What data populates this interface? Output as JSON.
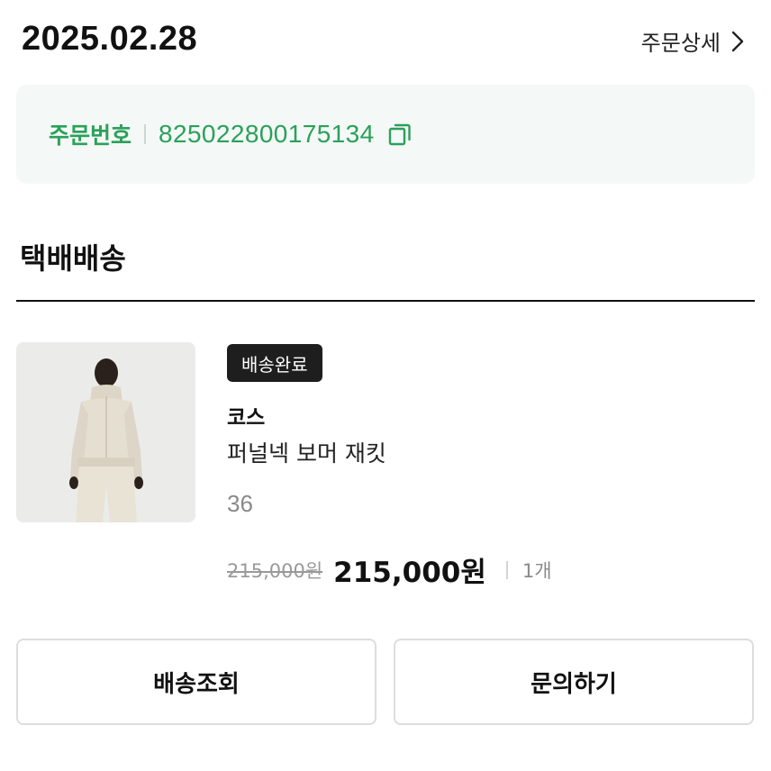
{
  "header": {
    "order_date": "2025.02.28",
    "detail_link_label": "주문상세"
  },
  "order": {
    "number_label": "주문번호",
    "number": "825022800175134",
    "accent_color": "#2aa15a"
  },
  "section": {
    "title": "택배배송"
  },
  "product": {
    "status": "배송완료",
    "brand": "코스",
    "name": "퍼널넥 보머 재킷",
    "option": "36",
    "original_price": "215,000원",
    "final_price": "215,000원",
    "quantity": "1개"
  },
  "actions": {
    "track_label": "배송조회",
    "inquiry_label": "문의하기"
  },
  "icons": {
    "detail": "chevron-right-icon",
    "copy": "copy-icon"
  }
}
